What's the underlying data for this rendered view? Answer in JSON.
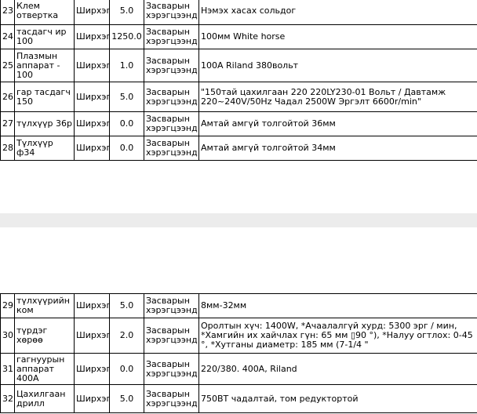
{
  "pages": [
    {
      "rows": [
        {
          "num": "23",
          "name": "Клем отвертка",
          "unit": "Ширхэг",
          "qty": "5.0",
          "category": "Засварын хэрэгцээнд",
          "desc": "Нэмэх хасах сольдог"
        },
        {
          "num": "24",
          "name": "тасдагч ир 100",
          "unit": "Ширхэг",
          "qty": "1250.0",
          "category": "Засварын хэрэгцээнд",
          "desc": "100мм White horse"
        },
        {
          "num": "25",
          "name": "Плазмын аппарат - 100",
          "unit": "Ширхэг",
          "qty": "1.0",
          "category": "Засварын хэрэгцээнд",
          "desc": "100A Riland 380вольт"
        },
        {
          "num": "26",
          "name": "гар тасдагч 150",
          "unit": "Ширхэг",
          "qty": "5.0",
          "category": "Засварын хэрэгцээнд",
          "desc": "\"150тай цахилгаан 220 220LY230-01 Вольт / Давтамж 220~240V/50Hz Чадал 2500W Эргэлт 6600r/min\""
        },
        {
          "num": "27",
          "name": "түлхүүр 36р",
          "unit": "Ширхэг",
          "qty": "0.0",
          "category": "Засварын хэрэгцээнд",
          "desc": "Амтай амгүй толгойтой 36мм"
        },
        {
          "num": "28",
          "name": "Түлхүүр ф34",
          "unit": "Ширхэг",
          "qty": "0.0",
          "category": "Засварын хэрэгцээнд",
          "desc": "Амтай амгүй толгойтой 34мм"
        }
      ]
    },
    {
      "rows": [
        {
          "num": "29",
          "name": "түлхүүрийн ком",
          "unit": "Ширхэг",
          "qty": "5.0",
          "category": "Засварын хэрэгцээнд",
          "desc": "8мм-32мм"
        },
        {
          "num": "30",
          "name": "түрдэг хөрөө",
          "unit": "Ширхэг",
          "qty": "2.0",
          "category": "Засварын хэрэгцээнд",
          "desc": "Оролтын хүч: 1400W, *Ачаалалгүй хурд: 5300 эрг / мин, *Хамгийн их хайчлах гүн: 65 мм ▯90 °), *Налуу огтлох: 0-45 °, *Хутганы диаметр: 185 мм (7-1/4 \""
        },
        {
          "num": "31",
          "name": "гагнуурын аппарат 400А",
          "unit": "Ширхэг",
          "qty": "0.0",
          "category": "Засварын хэрэгцээнд",
          "desc": "220/380. 400A, Riland"
        },
        {
          "num": "32",
          "name": "Цахилгаан дрилл",
          "unit": "Ширхэг",
          "qty": "5.0",
          "category": "Засварын хэрэгцээнд",
          "desc": "750ВТ чадалтай, том редуктортой"
        }
      ]
    }
  ],
  "colors": {
    "page_gap": "#ececec",
    "marker": "#e8231f",
    "border": "#000000"
  }
}
